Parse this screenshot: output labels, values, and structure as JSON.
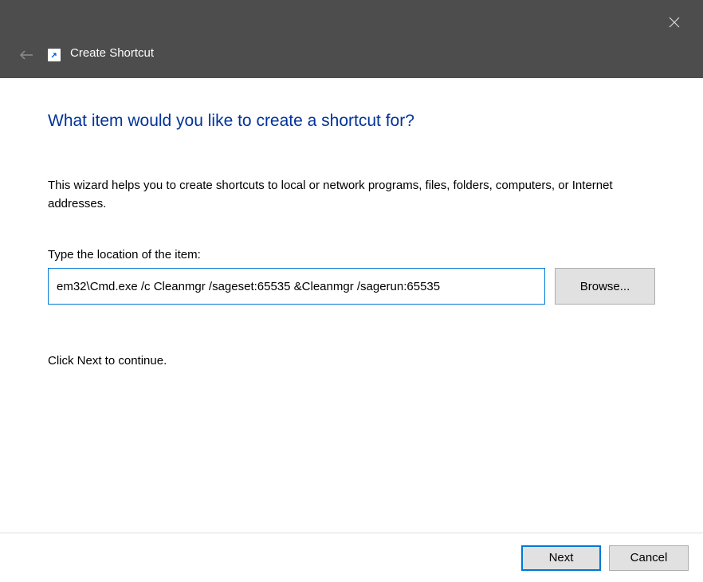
{
  "titlebar": {
    "title": "Create Shortcut"
  },
  "content": {
    "heading": "What item would you like to create a shortcut for?",
    "description": "This wizard helps you to create shortcuts to local or network programs, files, folders, computers, or Internet addresses.",
    "input_label": "Type the location of the item:",
    "location_value": "em32\\Cmd.exe /c Cleanmgr /sageset:65535 &Cleanmgr /sagerun:65535",
    "browse_label": "Browse...",
    "continue_text": "Click Next to continue."
  },
  "footer": {
    "next_label": "Next",
    "cancel_label": "Cancel"
  }
}
